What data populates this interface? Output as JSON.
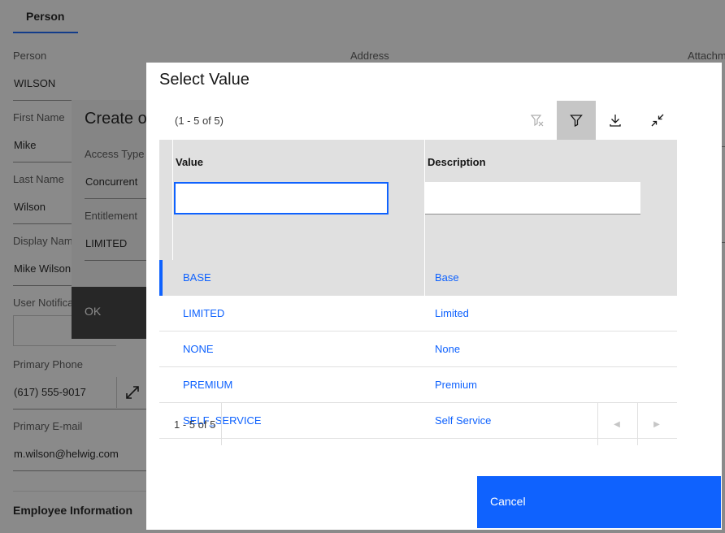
{
  "background": {
    "tab_label": "Person",
    "fields": [
      {
        "label": "Person",
        "value": "WILSON"
      },
      {
        "label": "First Name",
        "value": "Mike"
      },
      {
        "label": "Last Name",
        "value": "Wilson"
      },
      {
        "label": "Display Nam",
        "value": "Mike Wilson"
      },
      {
        "label": "User Notifica",
        "value": ""
      },
      {
        "label": "Primary Phone",
        "value": "(617) 555-9017"
      },
      {
        "label": "Primary E-mail",
        "value": "m.wilson@helwig.com"
      }
    ],
    "address_label": "Address",
    "attachments_label": "Attachm",
    "section_title": "Employee Information",
    "under_dialog": {
      "title": "Create o",
      "access_type_label": "Access Type",
      "access_type_value": "Concurrent",
      "entitlement_label": "Entitlement",
      "entitlement_value": "LIMITED",
      "ok_label": "OK"
    }
  },
  "modal": {
    "title": "Select Value",
    "count": "(1 - 5 of 5)",
    "toolbar_icons": [
      "clear-filter-icon",
      "filter-icon",
      "download-icon",
      "collapse-icon"
    ],
    "columns": [
      "Value",
      "Description"
    ],
    "filter_values": [
      "",
      ""
    ],
    "rows": [
      {
        "value": "BASE",
        "description": "Base",
        "selected": true
      },
      {
        "value": "LIMITED",
        "description": "Limited",
        "selected": false
      },
      {
        "value": "NONE",
        "description": "None",
        "selected": false
      },
      {
        "value": "PREMIUM",
        "description": "Premium",
        "selected": false
      },
      {
        "value": "SELF_SERVICE",
        "description": "Self Service",
        "selected": false
      }
    ],
    "pager_text": "1 - 5 of 5",
    "cancel_label": "Cancel",
    "accent_color": "#0f62fe"
  }
}
